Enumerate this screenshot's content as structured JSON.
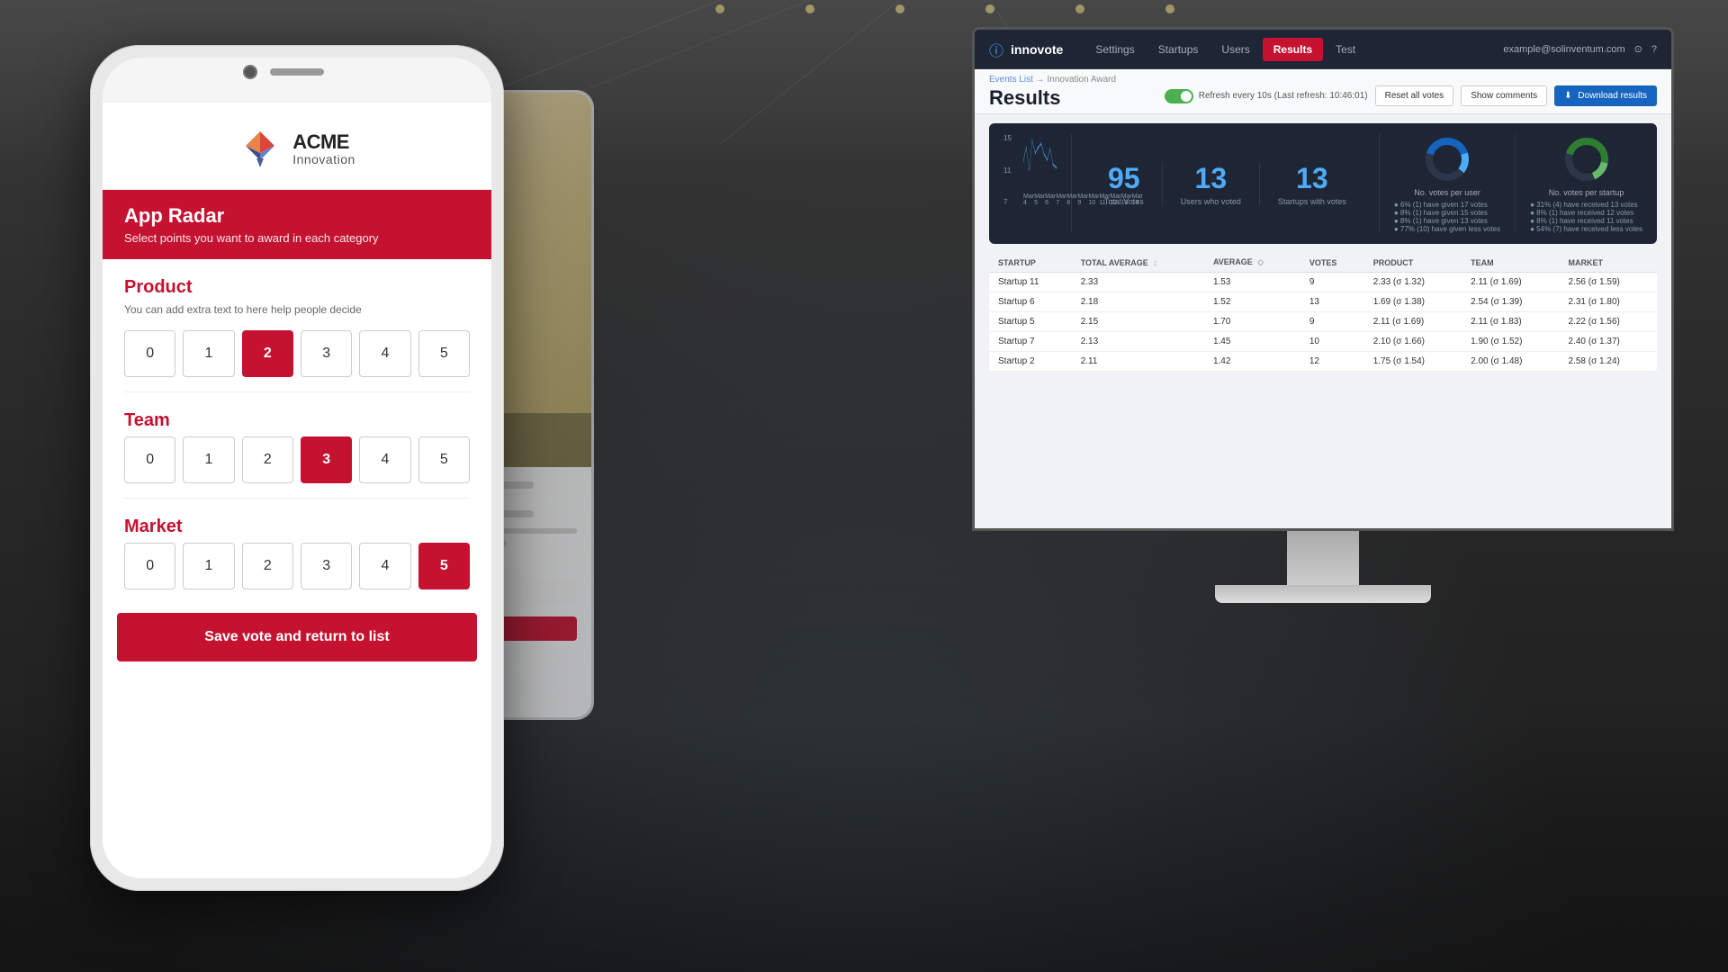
{
  "background": {
    "color": "#3a3a3a"
  },
  "phone": {
    "logo": {
      "company": "ACME",
      "tagline": "Innovation"
    },
    "app_header": {
      "title": "App Radar",
      "subtitle": "Select points you want to award in each category"
    },
    "categories": [
      {
        "id": "product",
        "name": "Product",
        "description": "You can add extra text to here help people decide",
        "options": [
          0,
          1,
          2,
          3,
          4,
          5
        ],
        "selected": 2
      },
      {
        "id": "team",
        "name": "Team",
        "description": "",
        "options": [
          0,
          1,
          2,
          3,
          4,
          5
        ],
        "selected": 3
      },
      {
        "id": "market",
        "name": "Market",
        "description": "",
        "options": [
          0,
          1,
          2,
          3,
          4,
          5
        ],
        "selected": 5
      }
    ],
    "save_button": "Save vote and return to list"
  },
  "desktop": {
    "nav": {
      "brand": "i innovote",
      "links": [
        "Settings",
        "Startups",
        "Users",
        "Results",
        "Test"
      ],
      "active_link": "Results",
      "user_email": "example@solinventum.com"
    },
    "breadcrumb": {
      "parent": "Events List",
      "arrow": "→",
      "current": "Innovation Award"
    },
    "page_title": "Results",
    "toolbar": {
      "refresh_label": "Refresh every 10s (Last refresh: 10:46:01)",
      "reset_button": "Reset all votes",
      "comments_button": "Show comments",
      "download_button": "Download results"
    },
    "chart": {
      "y_labels": [
        "15",
        "11",
        "7"
      ],
      "x_labels": [
        "Mar 4",
        "Mar 5",
        "Mar 6",
        "Mar 7",
        "Mar 8",
        "Mar 9",
        "Mar 10",
        "Mar 11",
        "Mar 12",
        "Mar 13",
        "Mar 14"
      ]
    },
    "stats": {
      "total_votes": {
        "value": "95",
        "label": "Total Votes"
      },
      "users_voted": {
        "value": "13",
        "label": "Users who voted"
      },
      "startups_votes": {
        "value": "13",
        "label": "Startups with votes"
      },
      "votes_per_user": {
        "label": "No. votes per user",
        "bullets": [
          "6% (1) have given 17 votes",
          "8% (1) have given 15 votes",
          "8% (1) have given 13 votes",
          "77% (10) have given less votes"
        ]
      },
      "votes_per_startup": {
        "label": "No. votes per startup",
        "bullets": [
          "31% (4) have received 13 votes",
          "8% (1) have received 12 votes",
          "8% (1) have received 11 votes",
          "54% (7) have received less votes"
        ]
      }
    },
    "table": {
      "columns": [
        "STARTUP",
        "TOTAL AVERAGE ↕",
        "AVERAGE ◇",
        "VOTES",
        "PRODUCT",
        "TEAM",
        "MARKET"
      ],
      "rows": [
        {
          "startup": "Startup 11",
          "total_avg": "2.33",
          "average": "1.53",
          "votes": "9",
          "product": "2.33 (σ 1.32)",
          "team": "2.11 (σ 1.69)",
          "market": "2.56 (σ 1.59)"
        },
        {
          "startup": "Startup 6",
          "total_avg": "2.18",
          "average": "1.52",
          "votes": "13",
          "product": "1.69 (σ 1.38)",
          "team": "2.54 (σ 1.39)",
          "market": "2.31 (σ 1.80)"
        },
        {
          "startup": "Startup 5",
          "total_avg": "2.15",
          "average": "1.70",
          "votes": "9",
          "product": "2.11 (σ 1.69)",
          "team": "2.11 (σ 1.83)",
          "market": "2.22 (σ 1.56)"
        },
        {
          "startup": "Startup 7",
          "total_avg": "2.13",
          "average": "1.45",
          "votes": "10",
          "product": "2.10 (σ 1.66)",
          "team": "1.90 (σ 1.52)",
          "market": "2.40 (σ 1.37)"
        },
        {
          "startup": "Startup 2",
          "total_avg": "2.11",
          "average": "1.42",
          "votes": "12",
          "product": "1.75 (σ 1.54)",
          "team": "2.00 (σ 1.48)",
          "market": "2.58 (σ 1.24)"
        }
      ]
    }
  }
}
